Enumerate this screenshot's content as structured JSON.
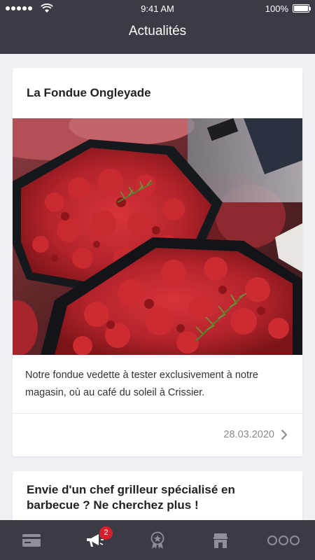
{
  "status_bar": {
    "time": "9:41 AM",
    "battery": "100%"
  },
  "header": {
    "title": "Actualités"
  },
  "feed": [
    {
      "title": "La Fondue Ongleyade",
      "image_icon": "marinated-beef-photo",
      "text": "Notre fondue vedette à tester exclusivement à notre magasin, où au café du soleil à Crissier.",
      "date": "28.03.2020"
    },
    {
      "title": "Envie d'un chef grilleur spécialisé en barbecue ? Ne cherchez plus !"
    }
  ],
  "tabbar": {
    "items": [
      {
        "icon": "card-icon"
      },
      {
        "icon": "megaphone-icon",
        "badge": "2"
      },
      {
        "icon": "medal-icon"
      },
      {
        "icon": "shop-icon"
      },
      {
        "icon": "more-icon"
      }
    ],
    "active_color": "#ffffff",
    "inactive_color": "#8e8f97",
    "badge_color": "#d5202b"
  },
  "colors": {
    "header_bg": "#3a3b45",
    "page_bg": "#efeff4"
  }
}
